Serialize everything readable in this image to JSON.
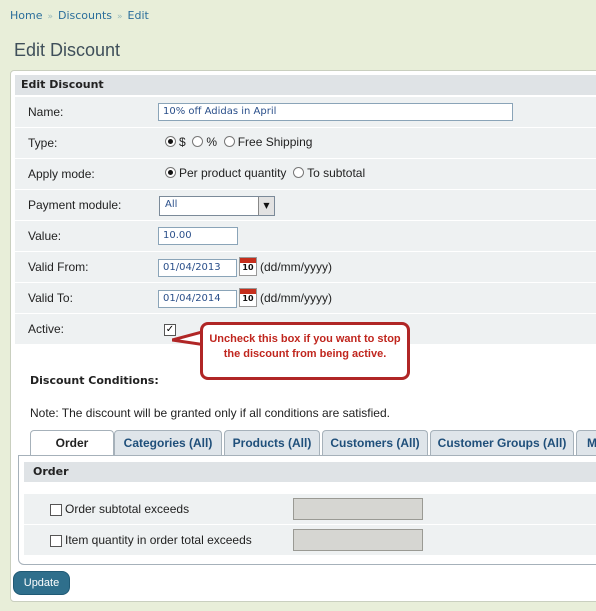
{
  "breadcrumb": {
    "home": "Home",
    "discounts": "Discounts",
    "edit": "Edit",
    "sep": "»"
  },
  "page_title": "Edit Discount",
  "panel_title": "Edit Discount",
  "form": {
    "name_label": "Name:",
    "name_value": "10% off Adidas in April",
    "type_label": "Type:",
    "type_options": [
      "$",
      "%",
      "Free Shipping"
    ],
    "type_selected": "$",
    "apply_label": "Apply mode:",
    "apply_options": [
      "Per product quantity",
      "To subtotal"
    ],
    "apply_selected": "Per product quantity",
    "payment_label": "Payment module:",
    "payment_value": "All",
    "value_label": "Value:",
    "value_value": "10.00",
    "from_label": "Valid From:",
    "from_value": "01/04/2013",
    "to_label": "Valid To:",
    "to_value": "01/04/2014",
    "date_format": "(dd/mm/yyyy)",
    "calendar_day": "10",
    "active_label": "Active:",
    "active_checked": true,
    "active_mark": "✓"
  },
  "callout": "Uncheck this box if you want to stop the discount from being active.",
  "conditions": {
    "title": "Discount Conditions:",
    "note": "Note: The discount will be granted only if all conditions are satisfied.",
    "tabs": [
      "Order",
      "Categories (All)",
      "Products (All)",
      "Customers (All)",
      "Customer Groups (All)",
      "M"
    ],
    "active_tab": "Order",
    "section_title": "Order",
    "rows": [
      {
        "label": "Order subtotal exceeds",
        "checked": false
      },
      {
        "label": "Item quantity in order total exceeds",
        "checked": false
      }
    ]
  },
  "update_label": "Update",
  "colors": {
    "callout_border": "#b02626",
    "callout_text": "#c0261e",
    "button": "#2f6f8c",
    "link": "#2b6e9b"
  }
}
